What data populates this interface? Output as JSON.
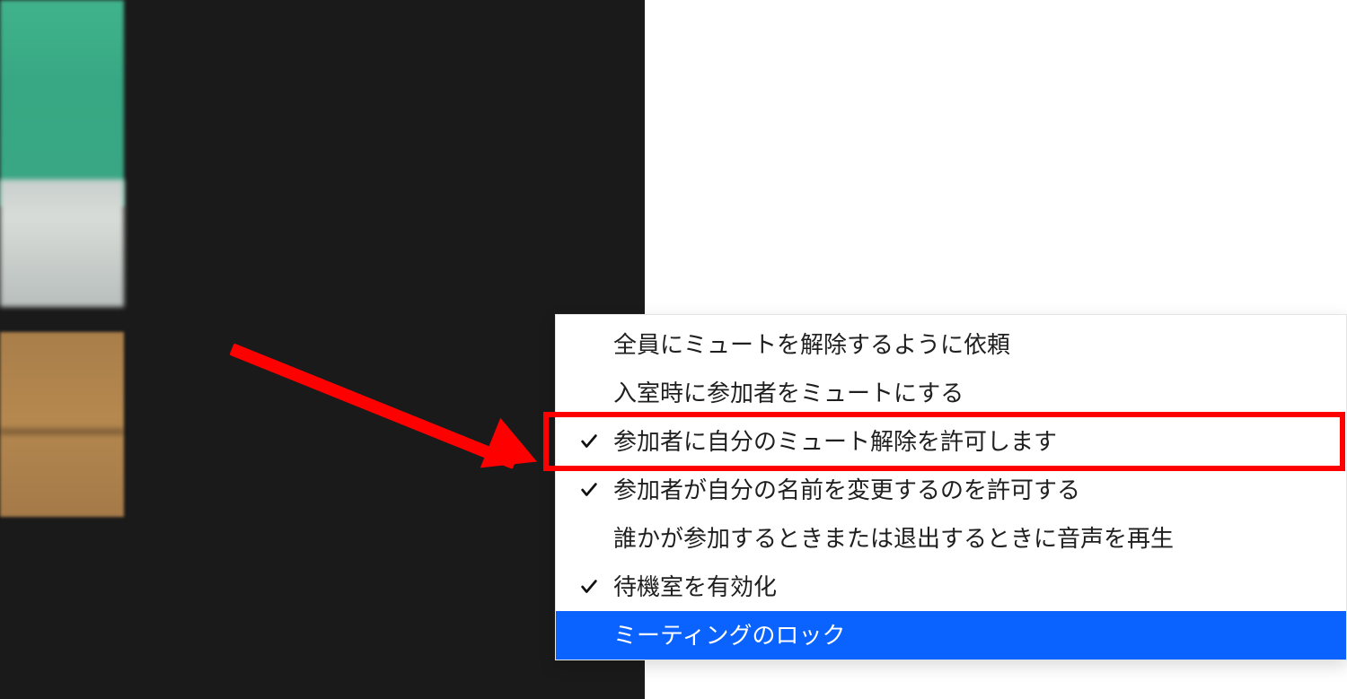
{
  "menu": {
    "items": [
      {
        "checked": false,
        "label": "全員にミュートを解除するように依頼"
      },
      {
        "checked": false,
        "label": "入室時に参加者をミュートにする"
      },
      {
        "checked": true,
        "label": "参加者に自分のミュート解除を許可します"
      },
      {
        "checked": true,
        "label": "参加者が自分の名前を変更するのを許可する"
      },
      {
        "checked": false,
        "label": "誰かが参加するときまたは退出するときに音声を再生"
      },
      {
        "checked": true,
        "label": "待機室を有効化"
      },
      {
        "checked": false,
        "label": "ミーティングのロック",
        "hover": true
      }
    ]
  },
  "annotation": {
    "highlighted_index": 2,
    "arrow_color": "#ff0000"
  }
}
